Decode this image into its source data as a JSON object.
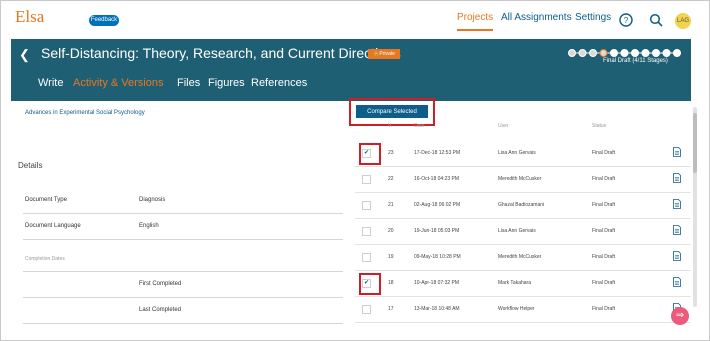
{
  "app": {
    "brand": "Elsa",
    "feedback": "Feedback"
  },
  "nav": {
    "projects": "Projects",
    "all_assignments": "All Assignments",
    "settings": "Settings",
    "avatar_initials": "LAG"
  },
  "header": {
    "title": "Self-Distancing: Theory, Research, and Current Directions",
    "private_badge": "Private",
    "stage_label": "Final Draft (4/11 Stages)",
    "stages_total": 11,
    "stages_current": 4,
    "tabs": [
      "Write",
      "Activity & Versions",
      "Files",
      "Figures",
      "References"
    ],
    "active_tab": "Activity & Versions"
  },
  "left": {
    "journal": "Advances in Experimental Social Psychology",
    "details_heading": "Details",
    "rows": [
      {
        "label": "Document Type",
        "value": "Diagnosis"
      },
      {
        "label": "Document Language",
        "value": "English"
      },
      {
        "label": "Completion Dates",
        "value": ""
      },
      {
        "label": "",
        "value": "First Completed"
      },
      {
        "label": "",
        "value": "Last Completed"
      }
    ]
  },
  "versions": {
    "compare_button": "Compare Selected",
    "columns": {
      "v": "V.",
      "date": "Date",
      "user": "User",
      "status": "Status"
    },
    "rows": [
      {
        "v": "23",
        "date": "17-Dec-18 12:53 PM",
        "user": "Lisa Ann Gervais",
        "status": "Final Draft",
        "checked": true
      },
      {
        "v": "22",
        "date": "16-Oct-18 04:23 PM",
        "user": "Meredith McCusker",
        "status": "Final Draft",
        "checked": false
      },
      {
        "v": "21",
        "date": "02-Aug-18 06:02 PM",
        "user": "Ghazal Badiozamani",
        "status": "Final Draft",
        "checked": false
      },
      {
        "v": "20",
        "date": "19-Jun-18 05:03 PM",
        "user": "Lisa Ann Gervais",
        "status": "Final Draft",
        "checked": false
      },
      {
        "v": "19",
        "date": "09-May-18 10:28 PM",
        "user": "Meredith McCusker",
        "status": "Final Draft",
        "checked": false
      },
      {
        "v": "18",
        "date": "10-Apr-18 07:32 PM",
        "user": "Mark Takahara",
        "status": "Final Draft",
        "checked": true
      },
      {
        "v": "17",
        "date": "13-Mar-18 10:48 AM",
        "user": "Workflow Helper",
        "status": "Final Draft",
        "checked": false
      }
    ]
  },
  "colors": {
    "accent": "#e87722",
    "header_band": "#1f5f74",
    "link": "#0e5d8a",
    "highlight": "#cc1f27"
  }
}
